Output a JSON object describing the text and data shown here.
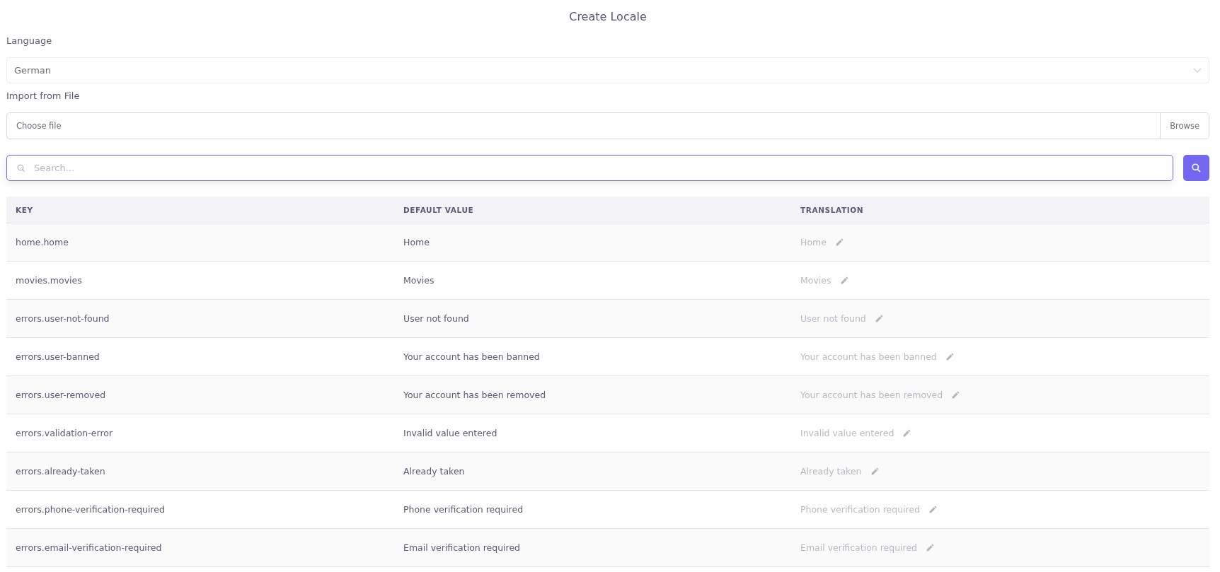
{
  "title": "Create Locale",
  "language": {
    "label": "Language",
    "value": "German"
  },
  "import": {
    "label": "Import from File",
    "placeholder": "Choose file",
    "button": "Browse"
  },
  "search": {
    "placeholder": "Search..."
  },
  "table": {
    "columns": [
      "KEY",
      "DEFAULT VALUE",
      "TRANSLATION"
    ],
    "rows": [
      {
        "key": "home.home",
        "default": "Home",
        "translation": "Home"
      },
      {
        "key": "movies.movies",
        "default": "Movies",
        "translation": "Movies"
      },
      {
        "key": "errors.user-not-found",
        "default": "User not found",
        "translation": "User not found"
      },
      {
        "key": "errors.user-banned",
        "default": "Your account has been banned",
        "translation": "Your account has been banned"
      },
      {
        "key": "errors.user-removed",
        "default": "Your account has been removed",
        "translation": "Your account has been removed"
      },
      {
        "key": "errors.validation-error",
        "default": "Invalid value entered",
        "translation": "Invalid value entered"
      },
      {
        "key": "errors.already-taken",
        "default": "Already taken",
        "translation": "Already taken"
      },
      {
        "key": "errors.phone-verification-required",
        "default": "Phone verification required",
        "translation": "Phone verification required"
      },
      {
        "key": "errors.email-verification-required",
        "default": "Email verification required",
        "translation": "Email verification required"
      }
    ]
  }
}
